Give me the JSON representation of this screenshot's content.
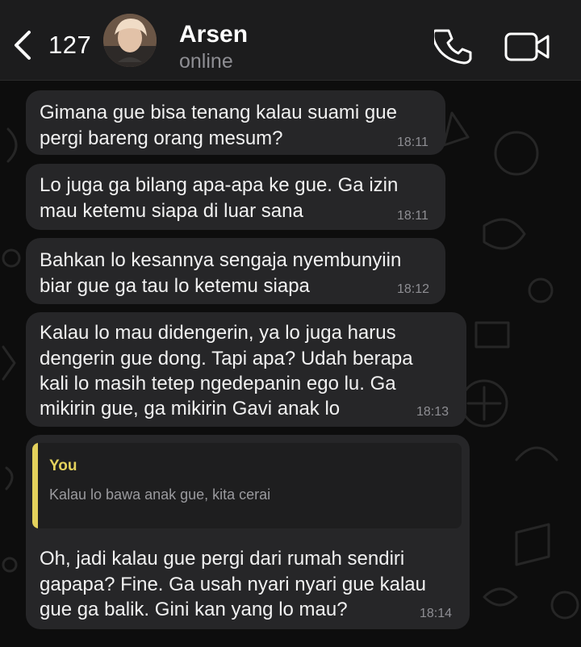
{
  "header": {
    "back_count": "127",
    "contact_name": "Arsen",
    "status": "online"
  },
  "messages": [
    {
      "lines": [
        "Gimana gue bisa tenang kalau suami gue",
        "pergi bareng orang mesum?"
      ],
      "time": "18:11"
    },
    {
      "lines": [
        "Lo juga ga bilang apa-apa ke gue. Ga izin",
        "mau ketemu siapa di luar sana"
      ],
      "time": "18:11"
    },
    {
      "lines": [
        "Bahkan lo kesannya sengaja nyembunyiin",
        "biar gue ga tau lo ketemu siapa"
      ],
      "time": "18:12"
    },
    {
      "lines": [
        "Kalau lo mau didengerin, ya lo juga harus",
        "dengerin gue dong. Tapi apa? Udah berapa",
        "kali lo masih tetep ngedepanin ego lu. Ga",
        "mikirin gue, ga mikirin Gavi anak lo"
      ],
      "time": "18:13"
    },
    {
      "reply": {
        "author": "You",
        "text": "Kalau lo bawa anak gue, kita cerai"
      },
      "lines": [
        "Oh, jadi kalau gue pergi dari rumah sendiri",
        "gapapa? Fine. Ga usah nyari nyari gue kalau",
        "gue ga balik. Gini kan yang lo mau?"
      ],
      "time": "18:14"
    }
  ],
  "colors": {
    "header_bg": "#1c1c1d",
    "bubble_bg": "#262628",
    "reply_accent": "#e3d15c",
    "timestamp": "#8e8e93"
  },
  "icons": [
    "chevron-left-icon",
    "phone-icon",
    "video-camera-icon"
  ]
}
